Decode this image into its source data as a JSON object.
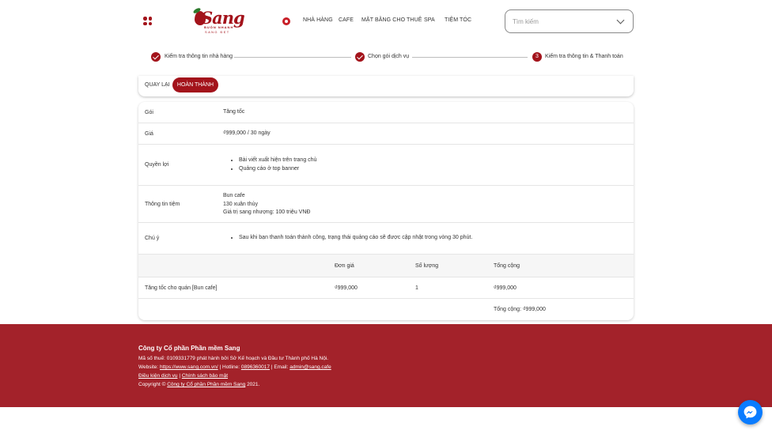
{
  "header": {
    "logo_text": "Sang",
    "logo_subtext": "BUÔN NHANH",
    "logo_subtext2": "SANG ĐẸT",
    "nav": [
      "NHÀ HÀNG",
      "CAFE",
      "MẶT BẰNG CHO THUÊ",
      "SPA",
      "TIỆM TÓC"
    ],
    "search_placeholder": "Tìm kiếm"
  },
  "stepper": {
    "steps": [
      {
        "label": "Kiểm tra thông tin nhà hàng",
        "state": "done"
      },
      {
        "label": "Chọn gói dịch vụ",
        "state": "done"
      },
      {
        "label": "Kiểm tra thông tin & Thanh toán",
        "state": "current",
        "number": "3"
      }
    ]
  },
  "actions": {
    "back_label": "QUAY LẠI",
    "done_label": "HOÀN THÀNH"
  },
  "summary": {
    "package_label": "Gói",
    "package_value": "Tăng tốc",
    "price_label": "Giá",
    "price_value": "₫999,000 / 30 ngày",
    "benefits_label": "Quyền lợi",
    "benefits": [
      "Bài viết xuất hiện trên trang chủ",
      "Quảng cáo ở top banner"
    ],
    "shop_label": "Thông tin tiệm",
    "shop_lines": [
      "Bun cafe",
      "130 xuân thủy",
      "Giá trị sang nhượng: 100 triệu VNĐ"
    ],
    "note_label": "Chú ý",
    "notes": [
      "Sau khi bạn thanh toán thành công, trạng thái quảng cáo sẽ được cập nhật trong vòng 30 phút."
    ]
  },
  "order_table": {
    "headers": [
      "",
      "Đơn giá",
      "Số lượng",
      "Tổng cộng"
    ],
    "rows": [
      [
        "Tăng tốc cho quán [Bun cafe]",
        "₫999,000",
        "1",
        "₫999,000"
      ]
    ],
    "total": "Tổng cộng: ₫999,000"
  },
  "footer": {
    "company": "Công ty Cổ phần Phần mềm Sang",
    "tax_line": "Mã số thuế: 0109331779 phát hành bởi Sở Kế hoạch và Đầu tư Thành phố Hà Nội.",
    "website_prefix": "Website:",
    "website": "https://www.sang.com.vn/",
    "hotline_prefix": "| Hotline:",
    "hotline": "0896360017",
    "email_prefix": "| Email:",
    "email": "admin@sang.cafe",
    "terms": "Điều kiện dịch vụ",
    "separator": "|",
    "privacy": "Chính sách bảo mật",
    "copyright_prefix": "Copyright ©",
    "copyright_company": "Công ty Cổ phần Phần mềm Sang",
    "copyright_year": "2021."
  },
  "colors": {
    "brand": "#a3131b",
    "footer_bg": "#a3222a",
    "messenger": "#0a7cff"
  }
}
